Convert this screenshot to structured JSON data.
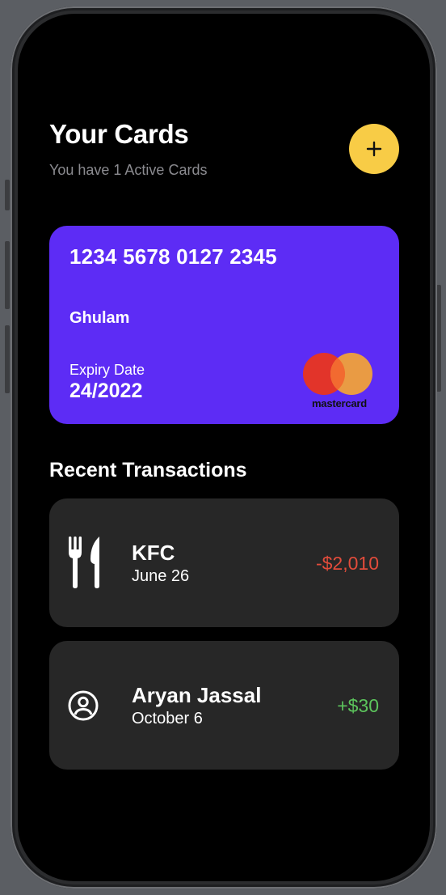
{
  "header": {
    "title": "Your Cards",
    "subtitle": "You have 1 Active Cards",
    "add_button_icon": "plus-icon"
  },
  "card": {
    "number": "1234 5678 0127 2345",
    "holder": "Ghulam",
    "expiry_label": "Expiry Date",
    "expiry_value": "24/2022",
    "brand": "mastercard",
    "background_color": "#5d2cf5"
  },
  "transactions": {
    "title": "Recent Transactions",
    "items": [
      {
        "name": "KFC",
        "date": "June 26",
        "amount": "-$2,010",
        "icon": "fork-knife-icon",
        "amount_color": "#e24c3b"
      },
      {
        "name": "Aryan Jassal",
        "date": "October 6",
        "amount": "+$30",
        "icon": "user-circle-icon",
        "amount_color": "#5cc45c"
      }
    ]
  },
  "colors": {
    "accent": "#f8cc46",
    "negative": "#e24c3b",
    "positive": "#5cc45c"
  }
}
